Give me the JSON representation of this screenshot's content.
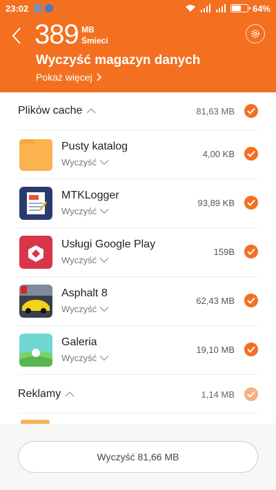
{
  "status_bar": {
    "time": "23:02",
    "battery_percent": "64%",
    "battery_level": 0.64
  },
  "header": {
    "junk_amount": "389",
    "junk_unit": "MB",
    "junk_label": "Śmieci",
    "title": "Wyczyść magazyn danych",
    "show_more": "Pokaż więcej"
  },
  "sections": [
    {
      "label": "Plików cache",
      "size": "81,63 MB",
      "checked": true,
      "items": [
        {
          "name": "Pusty katalog",
          "action": "Wyczyść",
          "size": "4,00 KB",
          "icon": "folder-icon"
        },
        {
          "name": "MTKLogger",
          "action": "Wyczyść",
          "size": "93,89 KB",
          "icon": "mtklogger-icon"
        },
        {
          "name": "Usługi Google Play",
          "action": "Wyczyść",
          "size": "159B",
          "icon": "google-play-services-icon"
        },
        {
          "name": "Asphalt 8",
          "action": "Wyczyść",
          "size": "62,43 MB",
          "icon": "asphalt-8-icon"
        },
        {
          "name": "Galeria",
          "action": "Wyczyść",
          "size": "19,10 MB",
          "icon": "gallery-icon"
        }
      ]
    },
    {
      "label": "Reklamy",
      "size": "1,14 MB",
      "checked": true
    }
  ],
  "clean_button": "Wyczyść 81,66 MB",
  "colors": {
    "accent": "#f37021",
    "accent_light": "#f8b07f"
  }
}
